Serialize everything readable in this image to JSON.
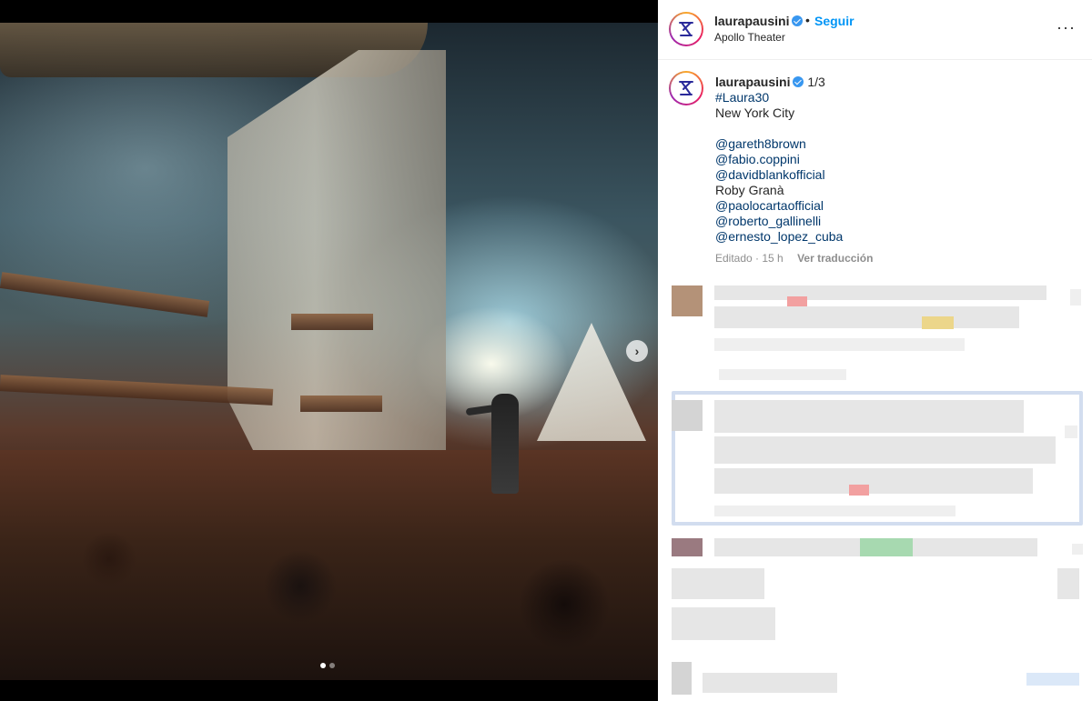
{
  "post": {
    "username": "laurapausini",
    "follow_label": "Seguir",
    "separator": "•",
    "location": "Apollo Theater",
    "more_label": "···"
  },
  "caption": {
    "username": "laurapausini",
    "counter": "1/3",
    "lines": [
      {
        "text": "#Laura30",
        "type": "link"
      },
      {
        "text": "New York City",
        "type": "text"
      },
      {
        "text": "",
        "type": "text"
      },
      {
        "text": "@gareth8brown",
        "type": "link"
      },
      {
        "text": "@fabio.coppini",
        "type": "link"
      },
      {
        "text": "@davidblankofficial",
        "type": "link"
      },
      {
        "text": "Roby Granà",
        "type": "text"
      },
      {
        "text": "@paolocartaofficial",
        "type": "link"
      },
      {
        "text": "@roberto_gallinelli",
        "type": "link"
      },
      {
        "text": "@ernesto_lopez_cuba",
        "type": "link"
      }
    ],
    "edited": "Editado · 15 h",
    "translate": "Ver traducción"
  },
  "media": {
    "next_icon": "chevron-right-icon",
    "carousel_position": 1,
    "carousel_total": 3
  },
  "colors": {
    "accent": "#0095f6",
    "link": "#00376b",
    "verified": "#3897f0"
  }
}
